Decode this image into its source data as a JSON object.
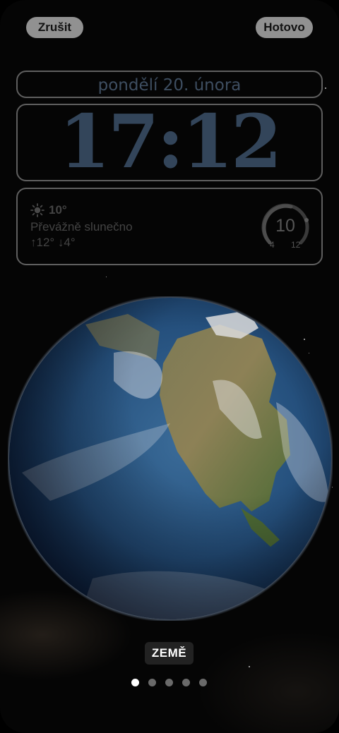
{
  "header": {
    "cancel_label": "Zrušit",
    "done_label": "Hotovo"
  },
  "lock_screen": {
    "date": "pondělí 20. února",
    "time": "17:12"
  },
  "weather_widget": {
    "icon": "sun-icon",
    "temperature": "10°",
    "condition": "Převážně slunečno",
    "range": "↑12° ↓4°",
    "gauge": {
      "value": "10",
      "min": "4",
      "max": "12"
    }
  },
  "wallpaper": {
    "name": "ZEMĚ",
    "page_count": 5,
    "active_page": 1
  },
  "colors": {
    "clock_text": "#33455a",
    "ocean": "#2c5580",
    "button_bg": "#c8c8c8"
  }
}
